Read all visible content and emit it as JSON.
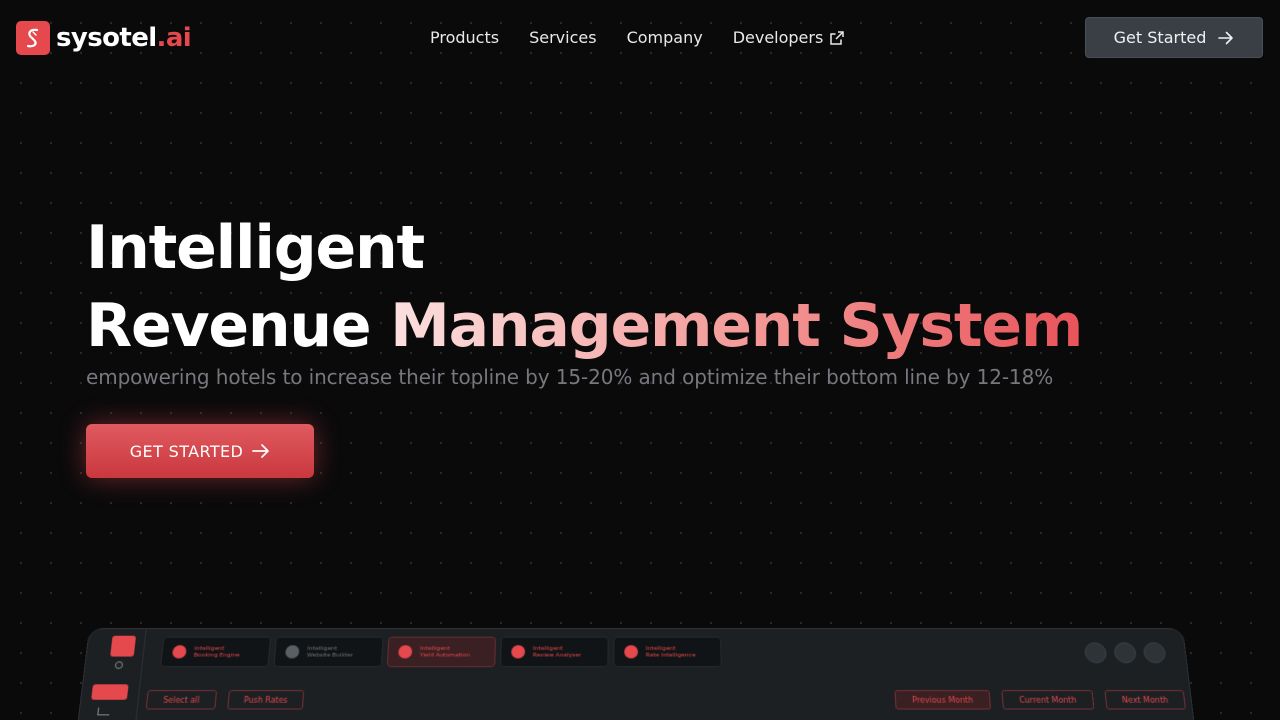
{
  "brand": {
    "name": "sysotel",
    "suffix": ".ai",
    "accent": "#e5484d"
  },
  "nav": {
    "links": [
      "Products",
      "Services",
      "Company",
      "Developers"
    ],
    "cta": "Get Started"
  },
  "hero": {
    "line1": "Intelligent",
    "line2_plain": "Revenue ",
    "line2_highlight": "Management System",
    "subtitle": "empowering hotels to increase their topline by 15-20% and optimize their bottom line by 12-18%",
    "cta": "GET STARTED"
  },
  "dashboard": {
    "tabs": [
      "Intelligent\nBooking Engine",
      "Intelligent\nWebsite Builder",
      "Intelligent\nYield Automation",
      "Intelligent\nReview Analyser",
      "Intelligent\nRate Intelligence"
    ],
    "select_all": "Select all",
    "push_rates": "Push Rates",
    "previous_month": "Previous Month",
    "current_month": "Current Month",
    "next_month": "Next Month"
  },
  "icons": {
    "external": "external-link-icon",
    "arrow": "arrow-right-icon"
  }
}
